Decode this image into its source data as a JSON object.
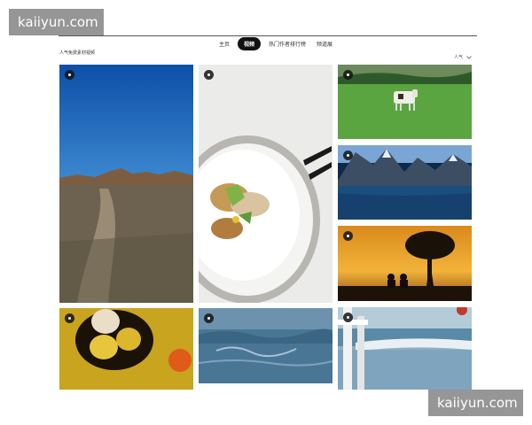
{
  "watermark": {
    "text": "kaiiyun.com"
  },
  "nav": {
    "items": [
      {
        "label": "主页",
        "active": false
      },
      {
        "label": "视频",
        "active": true
      },
      {
        "label": "热门作者排行榜",
        "active": false
      },
      {
        "label": "频道展",
        "active": false
      }
    ]
  },
  "section": {
    "title": "人气免费素材视频"
  },
  "sort": {
    "label": "人气",
    "icon": "chevron-down-icon"
  },
  "tiles": [
    {
      "subject": "desert-road",
      "play_icon": "play-icon"
    },
    {
      "subject": "food-plate",
      "play_icon": "play-icon"
    },
    {
      "subject": "cow-pasture",
      "play_icon": "play-icon"
    },
    {
      "subject": "mountain-lake",
      "play_icon": "play-icon"
    },
    {
      "subject": "sunset-silhouette",
      "play_icon": "play-icon"
    },
    {
      "subject": "eggs-nest",
      "play_icon": "play-icon"
    },
    {
      "subject": "ocean-waves",
      "play_icon": "play-icon"
    },
    {
      "subject": "beach-chair",
      "play_icon": "play-icon"
    }
  ],
  "colors": {
    "accent": "#111111",
    "background": "#ffffff"
  }
}
